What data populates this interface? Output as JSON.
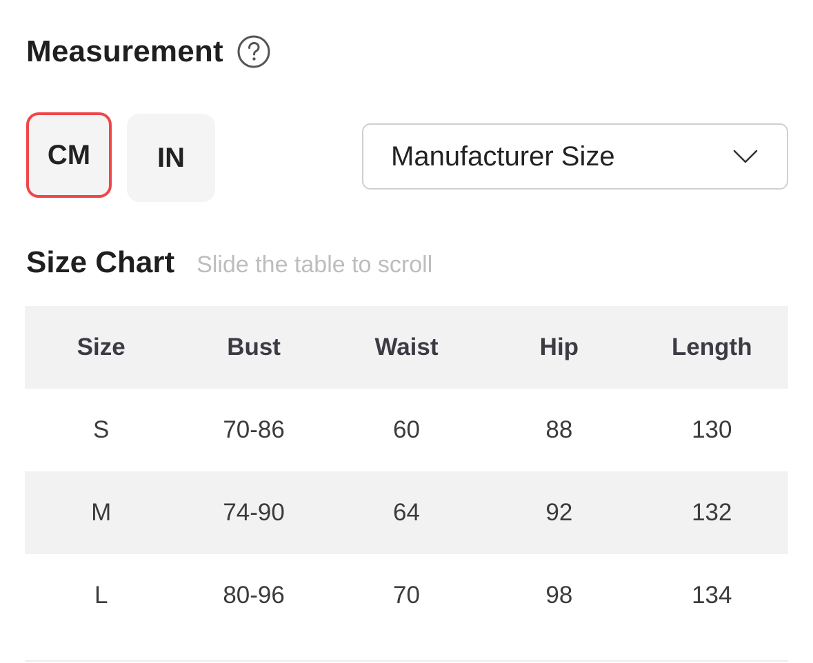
{
  "header": {
    "title": "Measurement",
    "help_icon": "question-circle-icon"
  },
  "units": {
    "options": [
      "CM",
      "IN"
    ],
    "selected": "CM",
    "active_border_color": "#f0464a"
  },
  "size_select": {
    "value": "Manufacturer Size",
    "icon": "chevron-down-icon"
  },
  "size_chart": {
    "title": "Size Chart",
    "hint": "Slide the table to scroll",
    "columns": [
      "Size",
      "Bust",
      "Waist",
      "Hip",
      "Length"
    ],
    "rows": [
      [
        "S",
        "70-86",
        "60",
        "88",
        "130"
      ],
      [
        "M",
        "74-90",
        "64",
        "92",
        "132"
      ],
      [
        "L",
        "80-96",
        "70",
        "98",
        "134"
      ]
    ]
  }
}
